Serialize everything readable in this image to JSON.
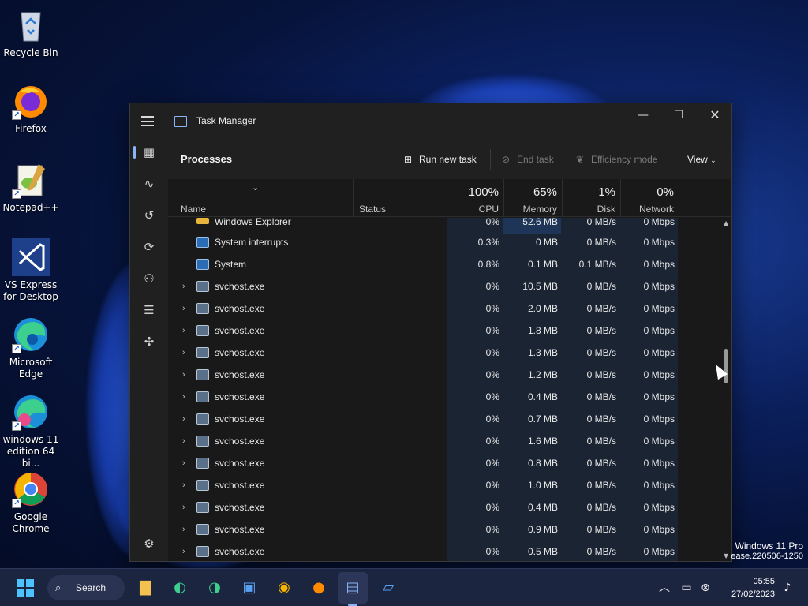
{
  "desktop": {
    "icons": [
      {
        "label": "Recycle Bin",
        "icon": "recycle-bin-icon"
      },
      {
        "label": "Firefox",
        "icon": "firefox-icon"
      },
      {
        "label": "Notepad++",
        "icon": "notepad-plus-plus-icon"
      },
      {
        "label": "VS Express for Desktop",
        "icon": "visual-studio-icon"
      },
      {
        "label": "Microsoft Edge",
        "icon": "edge-icon"
      },
      {
        "label": "windows 11 edition 64 bi...",
        "icon": "edge-dev-icon"
      },
      {
        "label": "Google Chrome",
        "icon": "chrome-icon"
      }
    ]
  },
  "window": {
    "title": "Task Manager",
    "minimize": "—",
    "maximize": "☐",
    "close": "✕"
  },
  "toolbar": {
    "page_title": "Processes",
    "run_new_task": "Run new task",
    "end_task": "End task",
    "efficiency_mode": "Efficiency mode",
    "view": "View"
  },
  "columns": {
    "name": "Name",
    "status": "Status",
    "cpu": {
      "pct": "100%",
      "label": "CPU"
    },
    "memory": {
      "pct": "65%",
      "label": "Memory"
    },
    "disk": {
      "pct": "1%",
      "label": "Disk"
    },
    "network": {
      "pct": "0%",
      "label": "Network"
    }
  },
  "rows": [
    {
      "name": "Windows Explorer",
      "cpu": "0%",
      "mem": "52.6 MB",
      "disk": "0 MB/s",
      "net": "0 Mbps",
      "expandable": false,
      "icon": "folder"
    },
    {
      "name": "System interrupts",
      "cpu": "0.3%",
      "mem": "0 MB",
      "disk": "0 MB/s",
      "net": "0 Mbps",
      "expandable": false,
      "icon": "sys"
    },
    {
      "name": "System",
      "cpu": "0.8%",
      "mem": "0.1 MB",
      "disk": "0.1 MB/s",
      "net": "0 Mbps",
      "expandable": false,
      "icon": "sys"
    },
    {
      "name": "svchost.exe",
      "cpu": "0%",
      "mem": "10.5 MB",
      "disk": "0 MB/s",
      "net": "0 Mbps",
      "expandable": true,
      "icon": "svc"
    },
    {
      "name": "svchost.exe",
      "cpu": "0%",
      "mem": "2.0 MB",
      "disk": "0 MB/s",
      "net": "0 Mbps",
      "expandable": true,
      "icon": "svc"
    },
    {
      "name": "svchost.exe",
      "cpu": "0%",
      "mem": "1.8 MB",
      "disk": "0 MB/s",
      "net": "0 Mbps",
      "expandable": true,
      "icon": "svc"
    },
    {
      "name": "svchost.exe",
      "cpu": "0%",
      "mem": "1.3 MB",
      "disk": "0 MB/s",
      "net": "0 Mbps",
      "expandable": true,
      "icon": "svc"
    },
    {
      "name": "svchost.exe",
      "cpu": "0%",
      "mem": "1.2 MB",
      "disk": "0 MB/s",
      "net": "0 Mbps",
      "expandable": true,
      "icon": "svc"
    },
    {
      "name": "svchost.exe",
      "cpu": "0%",
      "mem": "0.4 MB",
      "disk": "0 MB/s",
      "net": "0 Mbps",
      "expandable": true,
      "icon": "svc"
    },
    {
      "name": "svchost.exe",
      "cpu": "0%",
      "mem": "0.7 MB",
      "disk": "0 MB/s",
      "net": "0 Mbps",
      "expandable": true,
      "icon": "svc"
    },
    {
      "name": "svchost.exe",
      "cpu": "0%",
      "mem": "1.6 MB",
      "disk": "0 MB/s",
      "net": "0 Mbps",
      "expandable": true,
      "icon": "svc"
    },
    {
      "name": "svchost.exe",
      "cpu": "0%",
      "mem": "0.8 MB",
      "disk": "0 MB/s",
      "net": "0 Mbps",
      "expandable": true,
      "icon": "svc"
    },
    {
      "name": "svchost.exe",
      "cpu": "0%",
      "mem": "1.0 MB",
      "disk": "0 MB/s",
      "net": "0 Mbps",
      "expandable": true,
      "icon": "svc"
    },
    {
      "name": "svchost.exe",
      "cpu": "0%",
      "mem": "0.4 MB",
      "disk": "0 MB/s",
      "net": "0 Mbps",
      "expandable": true,
      "icon": "svc"
    },
    {
      "name": "svchost.exe",
      "cpu": "0%",
      "mem": "0.9 MB",
      "disk": "0 MB/s",
      "net": "0 Mbps",
      "expandable": true,
      "icon": "svc"
    },
    {
      "name": "svchost.exe",
      "cpu": "0%",
      "mem": "0.5 MB",
      "disk": "0 MB/s",
      "net": "0 Mbps",
      "expandable": true,
      "icon": "svc"
    }
  ],
  "watermark": {
    "line1": "Windows 11 Pro",
    "line2": "ease.220506-1250"
  },
  "taskbar": {
    "search_label": "Search",
    "time": "05:55",
    "date": "27/02/2023"
  }
}
